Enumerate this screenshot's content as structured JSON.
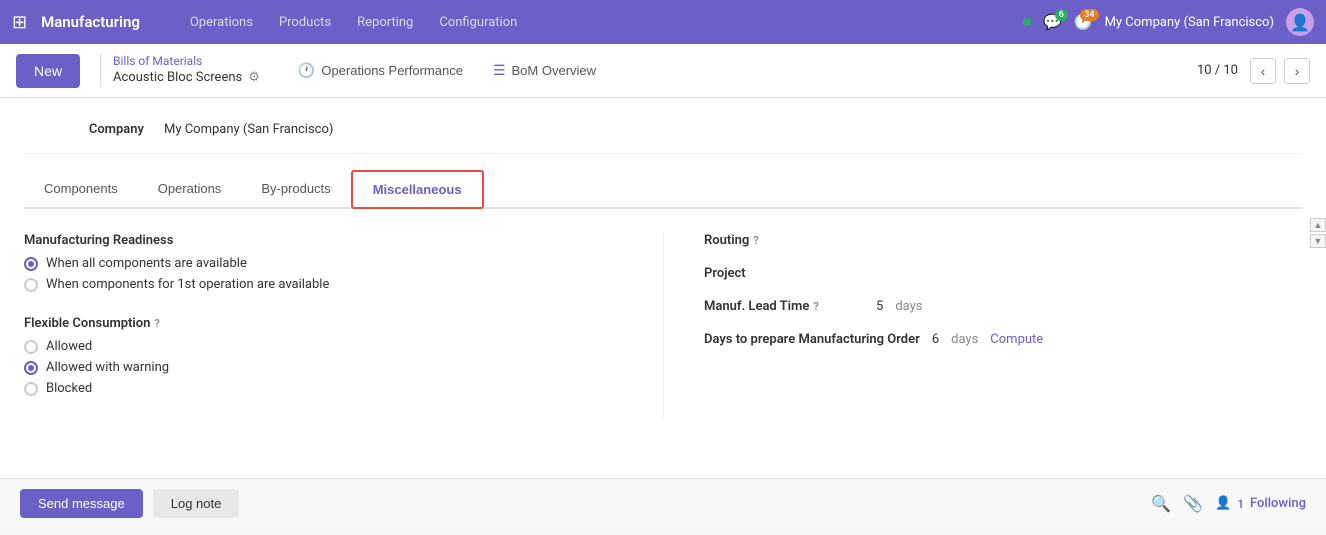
{
  "app": {
    "brand": "Manufacturing",
    "nav_links": [
      "Operations",
      "Products",
      "Reporting",
      "Configuration"
    ]
  },
  "topbar": {
    "dot_color": "#27ae60",
    "messages_count": "6",
    "activities_count": "34",
    "company": "My Company (San Francisco)"
  },
  "breadcrumb": {
    "new_label": "New",
    "title": "Bills of Materials",
    "subtitle": "Acoustic Bloc Screens"
  },
  "actions": {
    "ops_perf_label": "Operations Performance",
    "bom_overview_label": "BoM Overview"
  },
  "pagination": {
    "current": "10",
    "total": "10",
    "display": "10 / 10"
  },
  "company_field": {
    "label": "Company",
    "value": "My Company (San Francisco)"
  },
  "tabs": [
    {
      "id": "components",
      "label": "Components"
    },
    {
      "id": "operations",
      "label": "Operations"
    },
    {
      "id": "byproducts",
      "label": "By-products"
    },
    {
      "id": "miscellaneous",
      "label": "Miscellaneous"
    }
  ],
  "form": {
    "manufacturing_readiness": {
      "label": "Manufacturing Readiness",
      "options": [
        {
          "id": "all_components",
          "label": "When all components are available",
          "checked": true
        },
        {
          "id": "first_op",
          "label": "When components for 1st operation are available",
          "checked": false
        }
      ]
    },
    "flexible_consumption": {
      "label": "Flexible Consumption",
      "help": "?",
      "options": [
        {
          "id": "allowed",
          "label": "Allowed",
          "checked": false
        },
        {
          "id": "allowed_warning",
          "label": "Allowed with warning",
          "checked": true
        },
        {
          "id": "blocked",
          "label": "Blocked",
          "checked": false
        }
      ]
    },
    "routing": {
      "label": "Routing",
      "help": "?",
      "value": ""
    },
    "project": {
      "label": "Project",
      "value": ""
    },
    "manuf_lead_time": {
      "label": "Manuf. Lead Time",
      "help": "?",
      "value": "5",
      "unit": "days"
    },
    "days_prepare": {
      "label": "Days to prepare Manufacturing Order",
      "help": "?",
      "value": "6",
      "unit": "days",
      "action": "Compute"
    }
  },
  "footer": {
    "send_message_label": "Send message",
    "log_note_label": "Log note",
    "followers_count": "1",
    "following_label": "Following"
  }
}
